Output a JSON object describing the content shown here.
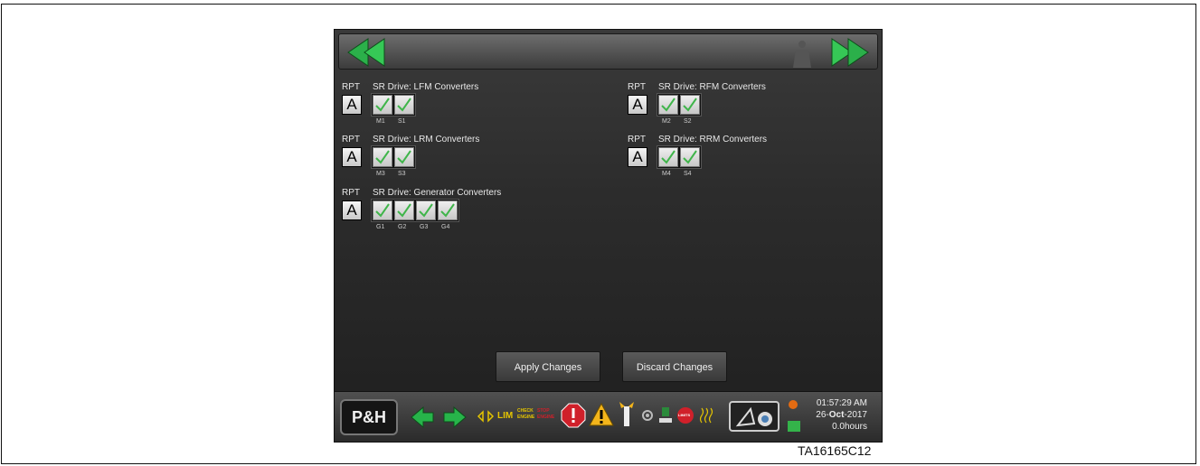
{
  "groups": [
    {
      "rpt": "RPT",
      "title": "SR Drive: LFM Converters",
      "button": "A",
      "labels": [
        "M1",
        "S1"
      ]
    },
    {
      "rpt": "RPT",
      "title": "SR Drive: RFM Converters",
      "button": "A",
      "labels": [
        "M2",
        "S2"
      ]
    },
    {
      "rpt": "RPT",
      "title": "SR Drive: LRM Converters",
      "button": "A",
      "labels": [
        "M3",
        "S3"
      ]
    },
    {
      "rpt": "RPT",
      "title": "SR Drive: RRM Converters",
      "button": "A",
      "labels": [
        "M4",
        "S4"
      ]
    },
    {
      "rpt": "RPT",
      "title": "SR Drive: Generator Converters",
      "button": "A",
      "labels": [
        "G1",
        "G2",
        "G3",
        "G4"
      ]
    }
  ],
  "actions": {
    "apply": "Apply Changes",
    "discard": "Discard Changes"
  },
  "bottombar": {
    "logo": "P&H",
    "indicators": {
      "lim": "LIM",
      "check_engine_top": "CHECK",
      "check_engine_bottom": "ENGINE",
      "stop_engine_top": "STOP",
      "stop_engine_bottom": "ENGINE",
      "limits": "LIMITS"
    },
    "time": "01:57:29 AM",
    "date_day": "26-",
    "date_month": "Oct",
    "date_year": "-2017",
    "hours": "0.0hours"
  },
  "caption": "TA16165C12",
  "colors": {
    "accent_green": "#27b44a",
    "check_green": "#3fb54a",
    "screen_bg": "#2c2c2c"
  }
}
